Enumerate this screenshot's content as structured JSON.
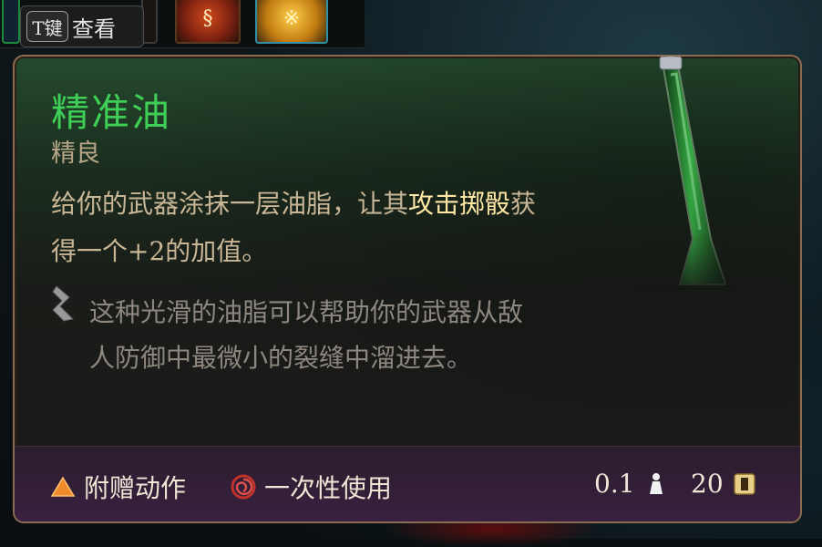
{
  "hint": {
    "key": "T键",
    "label": "查看"
  },
  "item": {
    "name": "精准油",
    "rarity": "精良",
    "description_prefix": "给你的武器涂抹一层油脂，让其",
    "description_highlight": "攻击掷骰",
    "description_suffix": "获得一个+2的加值。",
    "flavor": "这种光滑的油脂可以帮助你的武器从敌人防御中最微小的裂缝中溜进去。"
  },
  "footer": {
    "bonus_action": "附赠动作",
    "single_use": "一次性使用",
    "weight": "0.1",
    "price": "20"
  },
  "colors": {
    "name": "#3fcf56",
    "highlight": "#ffe8a6",
    "border": "#8a6c52",
    "bonus_icon": "#f08a2a",
    "single_use_icon": "#c0322a"
  },
  "icons": {
    "bonus": "triangle-icon",
    "single_use": "spiral-icon",
    "weight": "weight-icon",
    "price": "gold-coin-icon",
    "flavor": "quill-icon"
  }
}
